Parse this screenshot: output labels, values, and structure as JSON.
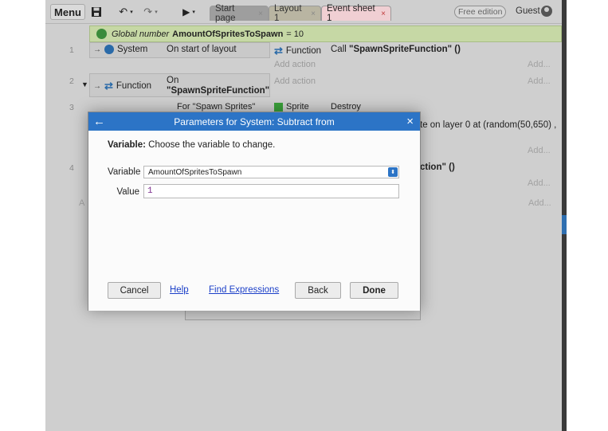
{
  "toolbar": {
    "menu_label": "Menu",
    "save_icon": "save-icon",
    "undo_glyph": "↶",
    "redo_glyph": "↷",
    "play_glyph": "▶",
    "caret_glyph": "▾",
    "tabs": [
      {
        "label": "Start page",
        "close": "×"
      },
      {
        "label": "Layout 1",
        "close": "×"
      },
      {
        "label": "Event sheet 1",
        "close": "×"
      }
    ],
    "free_edition": "Free edition",
    "guest": "Guest"
  },
  "sheet": {
    "global_prefix": "Global number",
    "global_name": "AmountOfSpritesToSpawn",
    "global_value": "= 10",
    "rows": [
      {
        "num": "1",
        "object": "System",
        "condition": "On start of layout",
        "action_object": "Function",
        "action_prefix": "Call",
        "action_value": "\"SpawnSpriteFunction\" ()",
        "add_action": "Add action",
        "add_right": "Add...",
        "add_right2": "Add..."
      },
      {
        "num": "2",
        "object": "Function",
        "condition_line1": "On",
        "condition_line2": "\"SpawnSpriteFunction\"",
        "add_action": "Add action",
        "add_right": "Add..."
      },
      {
        "num": "3",
        "cond_partial": "For \"Spawn Sprites\"",
        "action_obj_partial": "Sprite",
        "action_partial": "Destroy",
        "right_text": "te on layer 0 at (random(50,650) ,",
        "add_right": "Add..."
      },
      {
        "num": "4",
        "right_text": "ction\" ()",
        "add_right": "Add..."
      }
    ],
    "left_add": "A",
    "bottom_add": "Add..."
  },
  "dialog": {
    "title": "Parameters for System: Subtract from",
    "back_glyph": "←",
    "close_glyph": "×",
    "desc_bold": "Variable:",
    "desc_text": "Choose the variable to change.",
    "variable_label": "Variable",
    "variable_value": "AmountOfSpritesToSpawn",
    "value_label": "Value",
    "value_value": "1",
    "cancel": "Cancel",
    "help": "Help",
    "find_expressions": "Find Expressions",
    "back": "Back",
    "done": "Done"
  }
}
